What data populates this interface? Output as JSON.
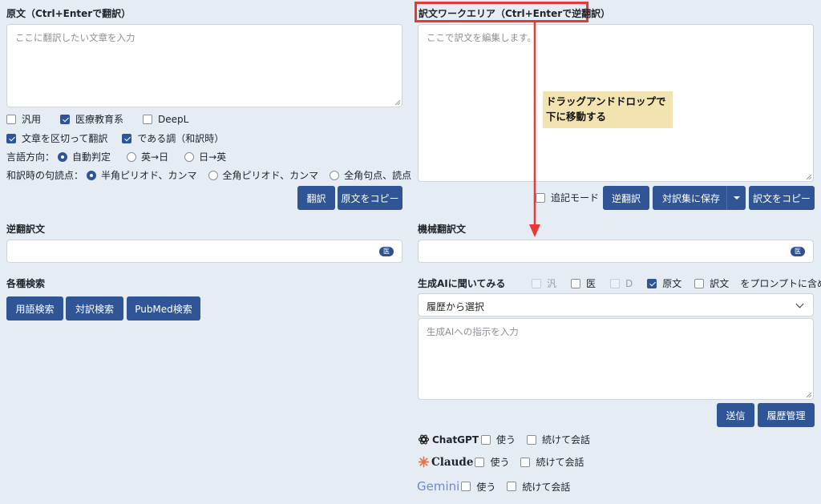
{
  "left": {
    "source_label": "原文（Ctrl+Enterで翻訳）",
    "source_placeholder": "ここに翻訳したい文章を入力",
    "options_row1": [
      {
        "label": "汎用",
        "checked": false
      },
      {
        "label": "医療教育系",
        "checked": true
      },
      {
        "label": "DeepL",
        "checked": false
      }
    ],
    "options_row2": [
      {
        "label": "文章を区切って翻訳",
        "checked": true
      },
      {
        "label": "である調（和訳時）",
        "checked": true
      }
    ],
    "direction_label": "言語方向：",
    "direction_options": [
      "自動判定",
      "英→日",
      "日→英"
    ],
    "punct_label": "和訳時の句読点：",
    "punct_options": [
      "半角ピリオド、カンマ",
      "全角ピリオド、カンマ",
      "全角句点、読点"
    ],
    "translate_button": "翻訳",
    "copy_source_button": "原文をコピー",
    "back_translation_label": "逆翻訳文",
    "badge_text": "医",
    "search_label": "各種検索",
    "search_buttons": [
      "用語検索",
      "対訳検索",
      "PubMed検索"
    ]
  },
  "right": {
    "work_label": "訳文ワークエリア（Ctrl+Enterで逆翻訳）",
    "work_placeholder": "ここで訳文を編集します。",
    "annotation": "ドラッグアンドドロップで\n下に移動する",
    "append_mode": "追記モード",
    "back_translate_button": "逆翻訳",
    "save_pair_button": "対訳集に保存",
    "copy_translation_button": "訳文をコピー",
    "machine_label": "機械翻訳文",
    "badge_text": "医",
    "ai_label": "生成AIに聞いてみる",
    "ai_options": [
      {
        "label": "汎",
        "checked": false,
        "disabled": true
      },
      {
        "label": "医",
        "checked": false,
        "disabled": false
      },
      {
        "label": "D",
        "checked": false,
        "disabled": true
      },
      {
        "label": "原文",
        "checked": true,
        "disabled": false
      },
      {
        "label": "訳文",
        "checked": false,
        "disabled": false
      }
    ],
    "ai_suffix": "をプロンプトに含める",
    "history_select": "履歴から選択",
    "ai_placeholder": "生成AIへの指示を入力",
    "send_button": "送信",
    "history_button": "履歴管理",
    "providers": [
      {
        "name": "ChatGPT",
        "use": "使う",
        "continue": "続けて会話"
      },
      {
        "name": "Claude",
        "use": "使う",
        "continue": "続けて会話"
      },
      {
        "name": "Gemini",
        "use": "使う",
        "continue": "続けて会話"
      }
    ]
  },
  "colors": {
    "primary": "#2f5597",
    "highlight": "#e53935",
    "note_bg": "#f3e3b0"
  }
}
